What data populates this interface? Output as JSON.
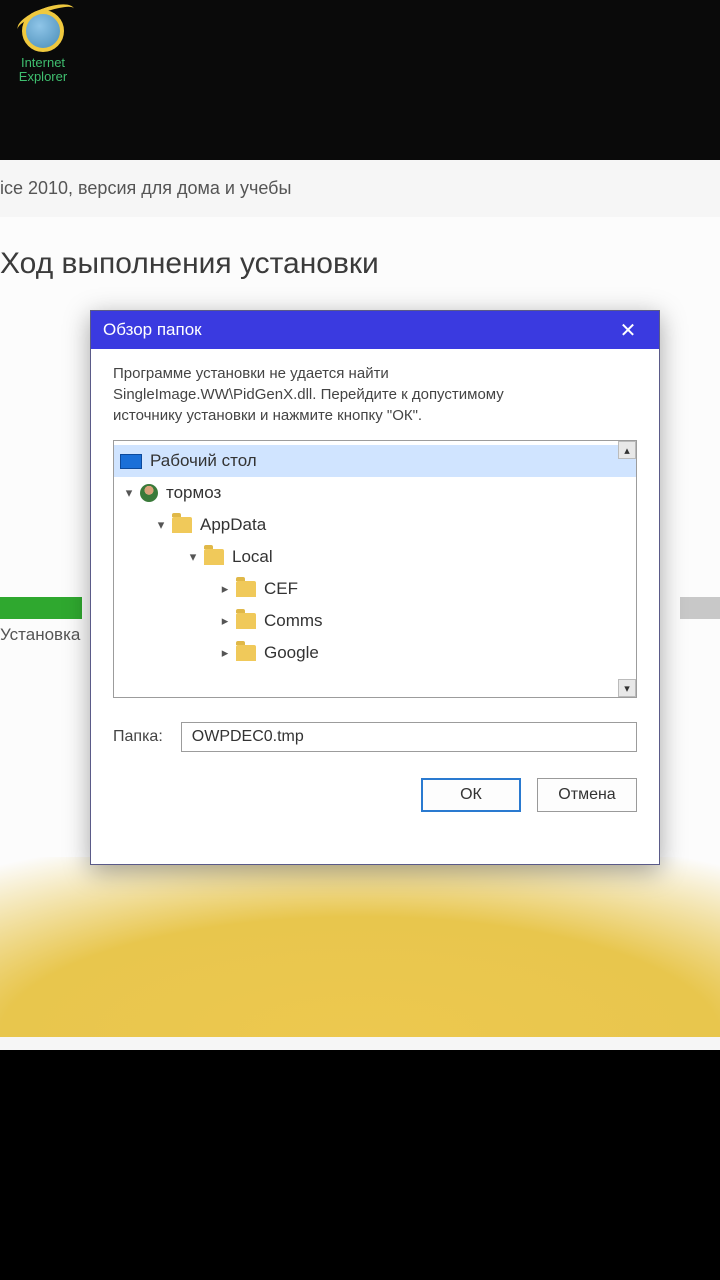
{
  "desktop": {
    "ie_label": "Internet Explorer"
  },
  "installer": {
    "window_title": "ice 2010, версия для дома и учебы",
    "heading": "Ход выполнения установки",
    "progress_label": "Установка"
  },
  "dialog": {
    "title": "Обзор папок",
    "message_line1": "Программе установки не удается найти",
    "message_line2": "SingleImage.WW\\PidGenX.dll. Перейдите к допустимому",
    "message_line3": "источнику установки и нажмите кнопку \"ОК\".",
    "tree": {
      "desktop": "Рабочий стол",
      "user": "тормоз",
      "appdata": "AppData",
      "local": "Local",
      "cef": "CEF",
      "comms": "Comms",
      "google": "Google"
    },
    "folder_label": "Папка:",
    "folder_value": "OWPDEC0.tmp",
    "ok": "ОК",
    "cancel": "Отмена"
  }
}
